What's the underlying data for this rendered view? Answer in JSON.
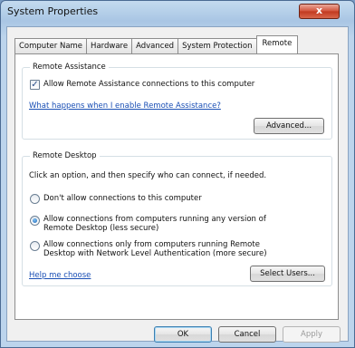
{
  "window": {
    "title": "System Properties",
    "close_label": "x"
  },
  "tabs": [
    {
      "label": "Computer Name",
      "active": false
    },
    {
      "label": "Hardware",
      "active": false
    },
    {
      "label": "Advanced",
      "active": false
    },
    {
      "label": "System Protection",
      "active": false
    },
    {
      "label": "Remote",
      "active": true
    }
  ],
  "remote_assistance": {
    "group_title": "Remote Assistance",
    "checkbox_label": "Allow Remote Assistance connections to this computer",
    "checkbox_checked": true,
    "help_link": "What happens when I enable Remote Assistance?",
    "advanced_button": "Advanced..."
  },
  "remote_desktop": {
    "group_title": "Remote Desktop",
    "instructions": "Click an option, and then specify who can connect, if needed.",
    "options": [
      {
        "label": "Don't allow connections to this computer",
        "checked": false
      },
      {
        "label": "Allow connections from computers running any version of Remote Desktop (less secure)",
        "checked": true
      },
      {
        "label": "Allow connections only from computers running Remote Desktop with Network Level Authentication (more secure)",
        "checked": false
      }
    ],
    "help_link": "Help me choose",
    "select_users_button": "Select Users..."
  },
  "footer": {
    "ok": "OK",
    "cancel": "Cancel",
    "apply": "Apply"
  }
}
